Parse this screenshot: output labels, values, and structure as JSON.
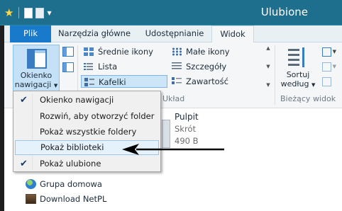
{
  "window": {
    "title": "Ulubione"
  },
  "quick_access": {
    "icons": [
      "star-icon",
      "properties-icon",
      "new-folder-icon",
      "customize-qat-icon"
    ]
  },
  "tabs": [
    {
      "label": "Plik",
      "type": "file"
    },
    {
      "label": "Narzędzia główne"
    },
    {
      "label": "Udostępnianie"
    },
    {
      "label": "Widok",
      "active": true
    }
  ],
  "ribbon": {
    "nav_pane_button": {
      "line1": "Okienko",
      "line2": "nawigacji"
    },
    "layout": {
      "items": [
        {
          "label": "Średnie ikony",
          "icon": "medium-icons-icon"
        },
        {
          "label": "Małe ikony",
          "icon": "small-icons-icon"
        },
        {
          "label": "Lista",
          "icon": "list-icon"
        },
        {
          "label": "Szczegóły",
          "icon": "details-icon"
        },
        {
          "label": "Kafelki",
          "icon": "tiles-icon",
          "selected": true
        },
        {
          "label": "Zawartość",
          "icon": "content-icon"
        }
      ],
      "group_label": "Układ"
    },
    "current_view": {
      "sort_line1": "Sortuj",
      "sort_line2": "według",
      "group_label": "Bieżący widok"
    }
  },
  "dropdown_menu": {
    "items": [
      {
        "label": "Okienko nawigacji",
        "checked": true
      },
      {
        "label": "Rozwiń, aby otworzyć folder",
        "checked": false
      },
      {
        "label": "Pokaż wszystkie foldery",
        "checked": false
      },
      {
        "label": "Pokaż biblioteki",
        "checked": false,
        "hover": true
      },
      {
        "label": "Pokaż ulubione",
        "checked": true
      }
    ],
    "check_glyph": "✔"
  },
  "file": {
    "name": "Pulpit",
    "type": "Skrót",
    "size": "490 B"
  },
  "sidebar": {
    "items": [
      {
        "label": "Grupa domowa",
        "icon": "homegroup-icon"
      },
      {
        "label": "Download NetPL",
        "icon": "user-avatar-icon"
      }
    ]
  },
  "colors": {
    "titlebar": "#1e6f8e",
    "file_tab": "#1979ca",
    "accent": "#3a7cc1"
  }
}
